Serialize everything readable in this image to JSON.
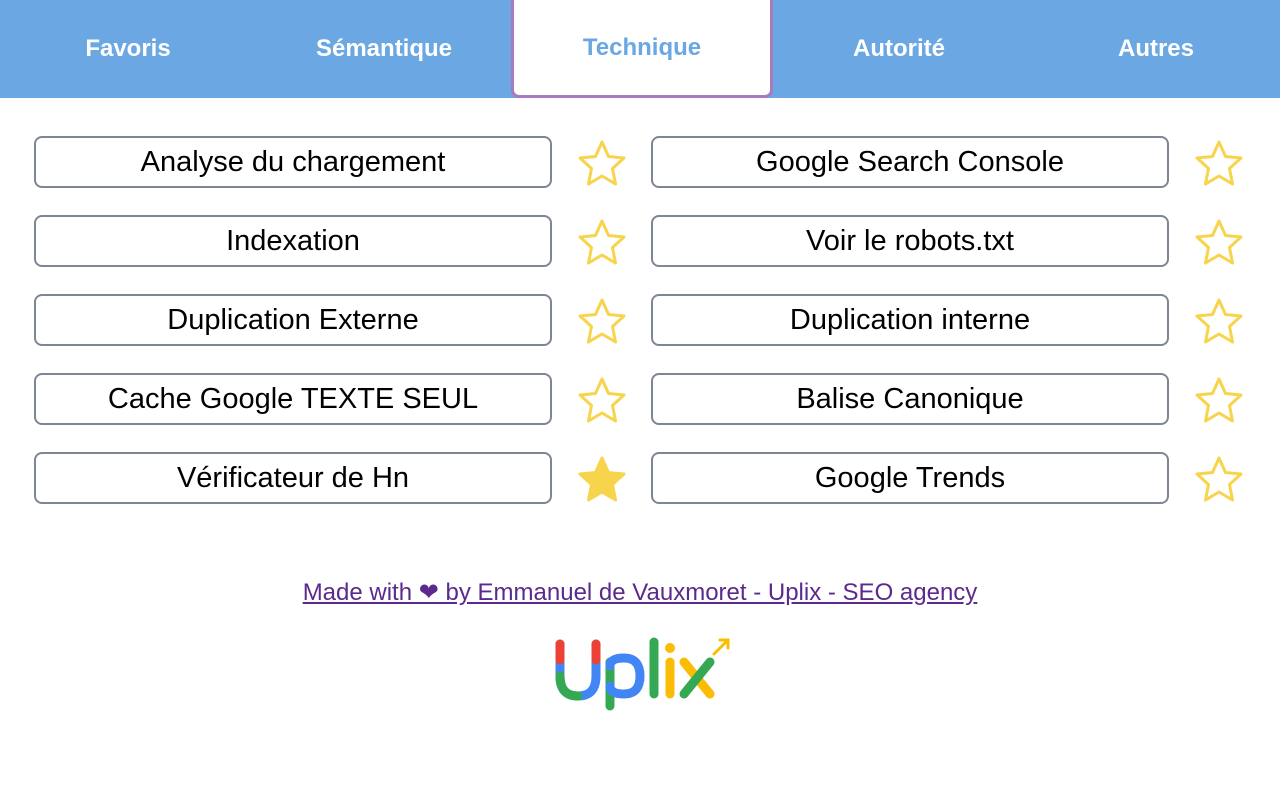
{
  "tabs": [
    {
      "label": "Favoris",
      "active": false
    },
    {
      "label": "Sémantique",
      "active": false
    },
    {
      "label": "Technique",
      "active": true
    },
    {
      "label": "Autorité",
      "active": false
    },
    {
      "label": "Autres",
      "active": false
    }
  ],
  "tools": {
    "left": [
      {
        "label": "Analyse du chargement",
        "favorite": false
      },
      {
        "label": "Indexation",
        "favorite": false
      },
      {
        "label": "Duplication Externe",
        "favorite": false
      },
      {
        "label": "Cache Google TEXTE SEUL",
        "favorite": false
      },
      {
        "label": "Vérificateur de Hn",
        "favorite": true
      }
    ],
    "right": [
      {
        "label": "Google Search Console",
        "favorite": false
      },
      {
        "label": "Voir le robots.txt",
        "favorite": false
      },
      {
        "label": "Duplication interne",
        "favorite": false
      },
      {
        "label": "Balise Canonique",
        "favorite": false
      },
      {
        "label": "Google Trends",
        "favorite": false
      }
    ]
  },
  "footer": {
    "credit": "Made with ❤ by Emmanuel de Vauxmoret - Uplix - SEO agency"
  },
  "logo": {
    "text": "Uplix"
  },
  "icons": {
    "star_empty": "star-outline-icon",
    "star_filled": "star-filled-icon"
  },
  "colors": {
    "tabbar": "#6aa7e3",
    "active_tab_border": "#a87bc0",
    "star": "#f7d44c",
    "link": "#5b2a8c"
  }
}
